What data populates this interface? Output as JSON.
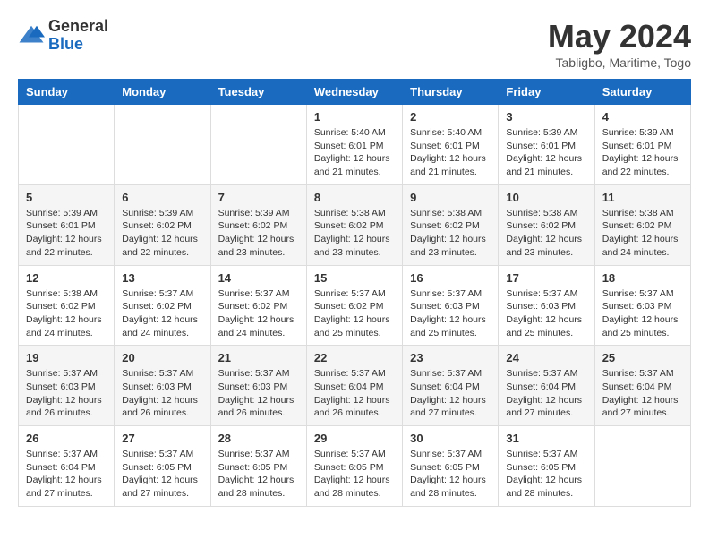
{
  "header": {
    "logo_general": "General",
    "logo_blue": "Blue",
    "month_year": "May 2024",
    "location": "Tabligbo, Maritime, Togo"
  },
  "calendar": {
    "days_of_week": [
      "Sunday",
      "Monday",
      "Tuesday",
      "Wednesday",
      "Thursday",
      "Friday",
      "Saturday"
    ],
    "weeks": [
      [
        {
          "day": "",
          "info": ""
        },
        {
          "day": "",
          "info": ""
        },
        {
          "day": "",
          "info": ""
        },
        {
          "day": "1",
          "info": "Sunrise: 5:40 AM\nSunset: 6:01 PM\nDaylight: 12 hours and 21 minutes."
        },
        {
          "day": "2",
          "info": "Sunrise: 5:40 AM\nSunset: 6:01 PM\nDaylight: 12 hours and 21 minutes."
        },
        {
          "day": "3",
          "info": "Sunrise: 5:39 AM\nSunset: 6:01 PM\nDaylight: 12 hours and 21 minutes."
        },
        {
          "day": "4",
          "info": "Sunrise: 5:39 AM\nSunset: 6:01 PM\nDaylight: 12 hours and 22 minutes."
        }
      ],
      [
        {
          "day": "5",
          "info": "Sunrise: 5:39 AM\nSunset: 6:01 PM\nDaylight: 12 hours and 22 minutes."
        },
        {
          "day": "6",
          "info": "Sunrise: 5:39 AM\nSunset: 6:02 PM\nDaylight: 12 hours and 22 minutes."
        },
        {
          "day": "7",
          "info": "Sunrise: 5:39 AM\nSunset: 6:02 PM\nDaylight: 12 hours and 23 minutes."
        },
        {
          "day": "8",
          "info": "Sunrise: 5:38 AM\nSunset: 6:02 PM\nDaylight: 12 hours and 23 minutes."
        },
        {
          "day": "9",
          "info": "Sunrise: 5:38 AM\nSunset: 6:02 PM\nDaylight: 12 hours and 23 minutes."
        },
        {
          "day": "10",
          "info": "Sunrise: 5:38 AM\nSunset: 6:02 PM\nDaylight: 12 hours and 23 minutes."
        },
        {
          "day": "11",
          "info": "Sunrise: 5:38 AM\nSunset: 6:02 PM\nDaylight: 12 hours and 24 minutes."
        }
      ],
      [
        {
          "day": "12",
          "info": "Sunrise: 5:38 AM\nSunset: 6:02 PM\nDaylight: 12 hours and 24 minutes."
        },
        {
          "day": "13",
          "info": "Sunrise: 5:37 AM\nSunset: 6:02 PM\nDaylight: 12 hours and 24 minutes."
        },
        {
          "day": "14",
          "info": "Sunrise: 5:37 AM\nSunset: 6:02 PM\nDaylight: 12 hours and 24 minutes."
        },
        {
          "day": "15",
          "info": "Sunrise: 5:37 AM\nSunset: 6:02 PM\nDaylight: 12 hours and 25 minutes."
        },
        {
          "day": "16",
          "info": "Sunrise: 5:37 AM\nSunset: 6:03 PM\nDaylight: 12 hours and 25 minutes."
        },
        {
          "day": "17",
          "info": "Sunrise: 5:37 AM\nSunset: 6:03 PM\nDaylight: 12 hours and 25 minutes."
        },
        {
          "day": "18",
          "info": "Sunrise: 5:37 AM\nSunset: 6:03 PM\nDaylight: 12 hours and 25 minutes."
        }
      ],
      [
        {
          "day": "19",
          "info": "Sunrise: 5:37 AM\nSunset: 6:03 PM\nDaylight: 12 hours and 26 minutes."
        },
        {
          "day": "20",
          "info": "Sunrise: 5:37 AM\nSunset: 6:03 PM\nDaylight: 12 hours and 26 minutes."
        },
        {
          "day": "21",
          "info": "Sunrise: 5:37 AM\nSunset: 6:03 PM\nDaylight: 12 hours and 26 minutes."
        },
        {
          "day": "22",
          "info": "Sunrise: 5:37 AM\nSunset: 6:04 PM\nDaylight: 12 hours and 26 minutes."
        },
        {
          "day": "23",
          "info": "Sunrise: 5:37 AM\nSunset: 6:04 PM\nDaylight: 12 hours and 27 minutes."
        },
        {
          "day": "24",
          "info": "Sunrise: 5:37 AM\nSunset: 6:04 PM\nDaylight: 12 hours and 27 minutes."
        },
        {
          "day": "25",
          "info": "Sunrise: 5:37 AM\nSunset: 6:04 PM\nDaylight: 12 hours and 27 minutes."
        }
      ],
      [
        {
          "day": "26",
          "info": "Sunrise: 5:37 AM\nSunset: 6:04 PM\nDaylight: 12 hours and 27 minutes."
        },
        {
          "day": "27",
          "info": "Sunrise: 5:37 AM\nSunset: 6:05 PM\nDaylight: 12 hours and 27 minutes."
        },
        {
          "day": "28",
          "info": "Sunrise: 5:37 AM\nSunset: 6:05 PM\nDaylight: 12 hours and 28 minutes."
        },
        {
          "day": "29",
          "info": "Sunrise: 5:37 AM\nSunset: 6:05 PM\nDaylight: 12 hours and 28 minutes."
        },
        {
          "day": "30",
          "info": "Sunrise: 5:37 AM\nSunset: 6:05 PM\nDaylight: 12 hours and 28 minutes."
        },
        {
          "day": "31",
          "info": "Sunrise: 5:37 AM\nSunset: 6:05 PM\nDaylight: 12 hours and 28 minutes."
        },
        {
          "day": "",
          "info": ""
        }
      ]
    ]
  }
}
